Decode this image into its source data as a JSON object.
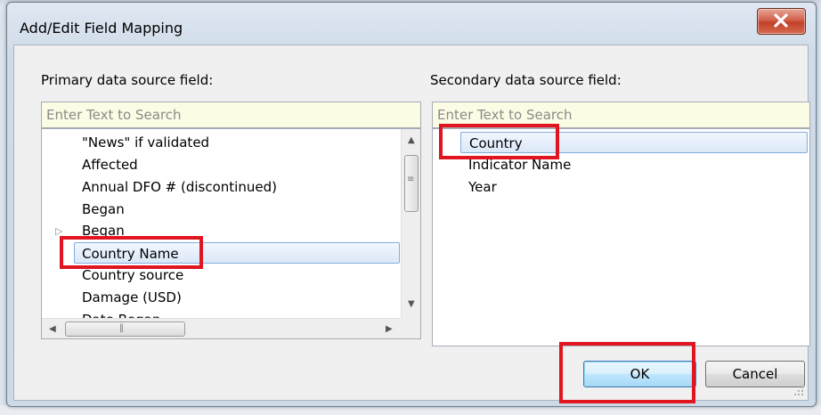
{
  "window": {
    "title": "Add/Edit Field Mapping",
    "close_glyph": "X",
    "close_color": "#c7462e"
  },
  "primary": {
    "label": "Primary data source field:",
    "search_placeholder": "Enter Text to Search",
    "items": [
      "\"News\" if validated",
      "Affected",
      "Annual DFO # (discontinued)",
      "Began",
      "Began",
      "Country Name",
      "Country source",
      "Damage (USD)",
      "Date Began"
    ],
    "selected": "Country Name",
    "expandable_item": "Began",
    "scroll_position": 0.2
  },
  "secondary": {
    "label": "Secondary data source field:",
    "search_placeholder": "Enter Text to Search",
    "items": [
      "Country",
      "Indicator Name",
      "Year"
    ],
    "selected": "Country"
  },
  "buttons": {
    "ok": "OK",
    "cancel": "Cancel"
  },
  "annotation": {
    "highlight_color": "#e0151f",
    "highlighted": [
      "Country Name",
      "Country",
      "OK"
    ]
  },
  "icons": {
    "close": "close-x-icon",
    "expander": "triangle-right-icon",
    "scroll_up": "arrow-up-icon",
    "scroll_down": "arrow-down-icon",
    "scroll_left": "arrow-left-icon",
    "scroll_right": "arrow-right-icon"
  }
}
